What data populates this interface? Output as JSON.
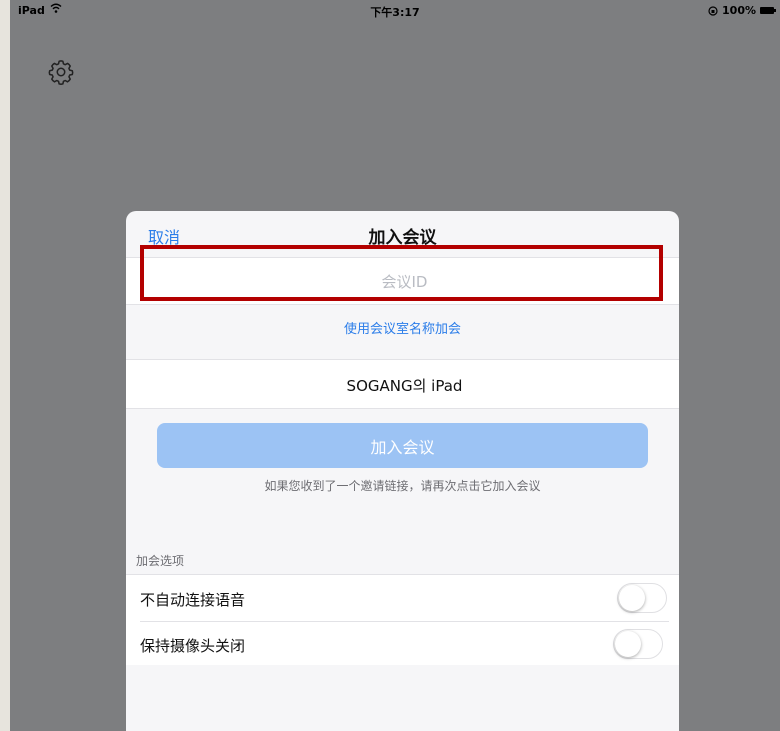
{
  "status_bar": {
    "carrier": "iPad",
    "time": "下午3:17",
    "battery": "100%"
  },
  "icons": {
    "settings": "gear-icon",
    "wifi": "wifi-icon",
    "battery": "battery-icon",
    "orientation_lock": "orientation-lock-icon"
  },
  "dialog": {
    "cancel_label": "取消",
    "title": "加入会议",
    "meeting_id_placeholder": "会议ID",
    "meeting_id_value": "",
    "room_name_link": "使用会议室名称加会",
    "display_name": "SOGANG의 iPad",
    "join_button": "加入会议",
    "hint": "如果您收到了一个邀请链接，请再次点击它加入会议"
  },
  "options": {
    "title": "加会选项",
    "items": [
      {
        "label": "不自动连接语音",
        "on": false
      },
      {
        "label": "保持摄像头关闭",
        "on": false
      }
    ]
  },
  "colors": {
    "accent": "#2b7de9",
    "join_button": "#9cc3f4",
    "highlight": "#b30000"
  }
}
